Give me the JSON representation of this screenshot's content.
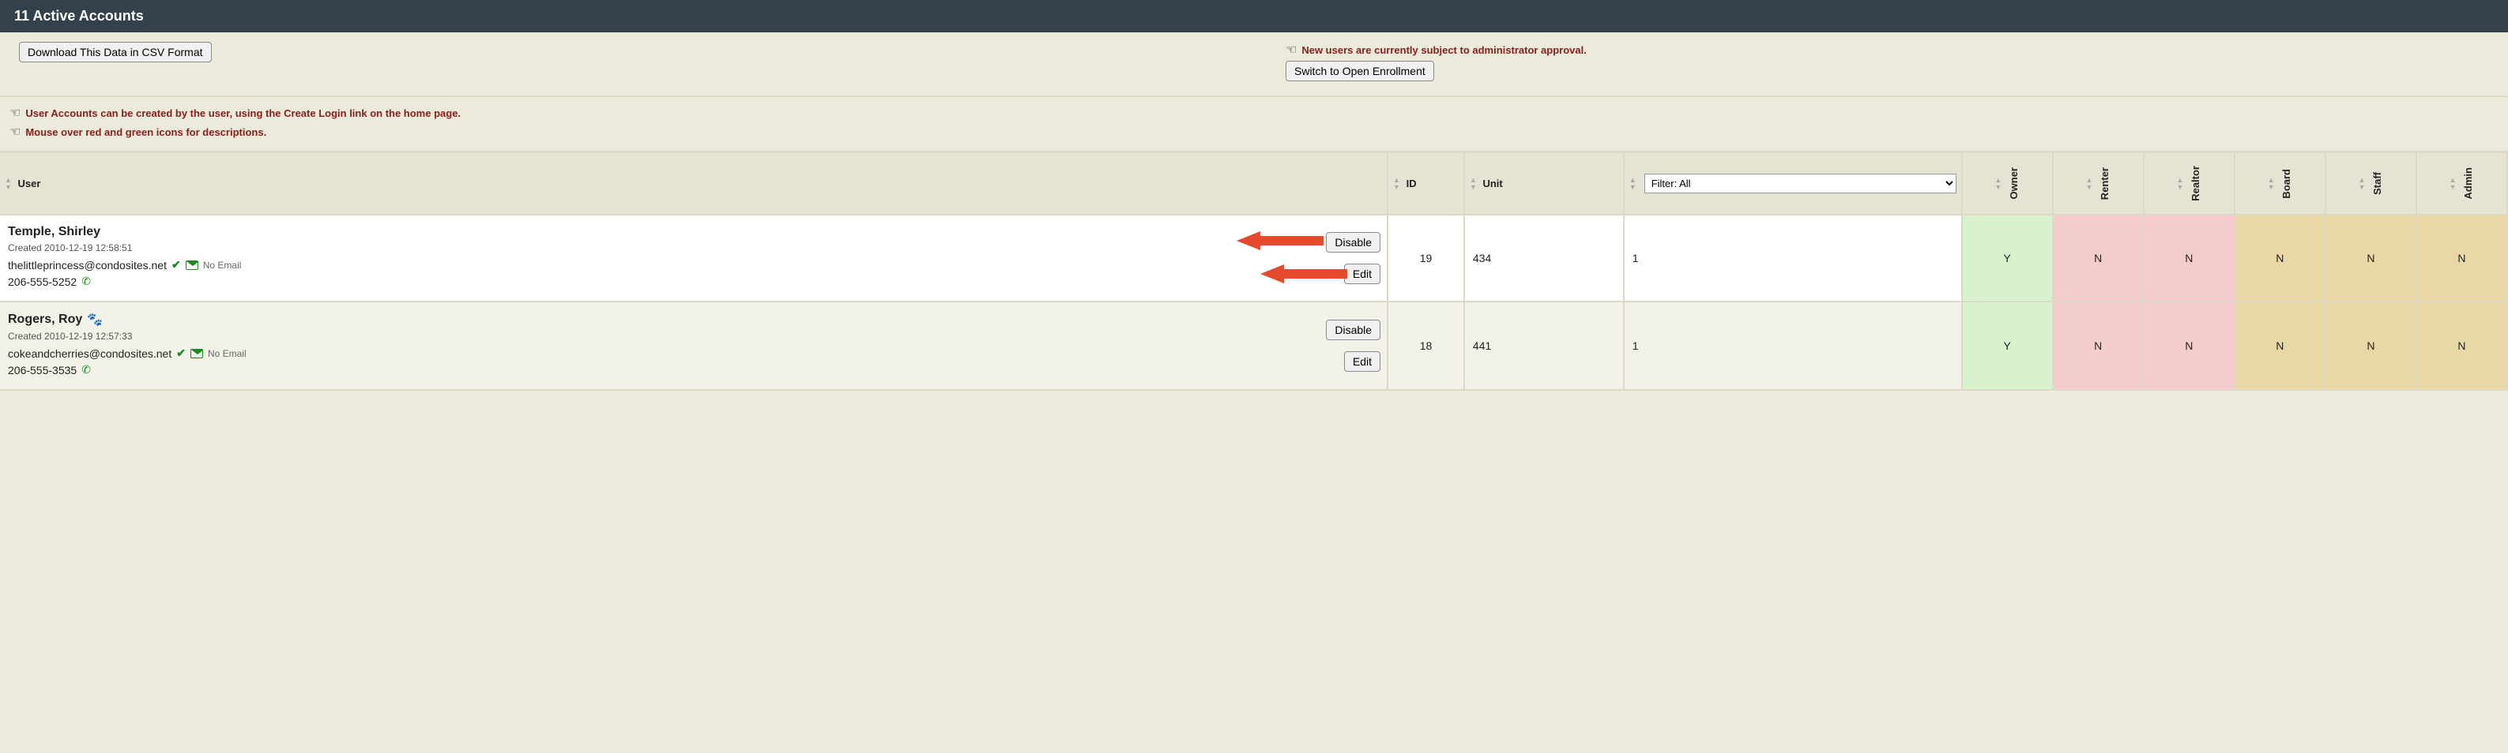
{
  "header": {
    "title": "11 Active Accounts"
  },
  "toolbar": {
    "download_csv_label": "Download This Data in CSV Format",
    "approval_note": "New users are currently subject to administrator approval.",
    "switch_enrollment_label": "Switch to Open Enrollment"
  },
  "notes": {
    "create_login_note": "User Accounts can be created by the user, using the Create Login link on the home page.",
    "mouseover_note": "Mouse over red and green icons for descriptions."
  },
  "columns": {
    "user": "User",
    "id": "ID",
    "unit": "Unit",
    "filter_selected": "Filter: All",
    "owner": "Owner",
    "renter": "Renter",
    "realtor": "Realtor",
    "board": "Board",
    "staff": "Staff",
    "admin": "Admin"
  },
  "actions": {
    "disable": "Disable",
    "edit": "Edit",
    "no_email": "No Email"
  },
  "rows": [
    {
      "name": "Temple, Shirley",
      "created": "Created 2010-12-19 12:58:51",
      "email": "thelittleprincess@condosites.net",
      "phone": "206-555-5252",
      "has_pet": false,
      "id": "19",
      "unit": "434",
      "filter": "1",
      "owner": "Y",
      "renter": "N",
      "realtor": "N",
      "board": "N",
      "staff": "N",
      "admin": "N",
      "show_arrows": true
    },
    {
      "name": "Rogers, Roy",
      "created": "Created 2010-12-19 12:57:33",
      "email": "cokeandcherries@condosites.net",
      "phone": "206-555-3535",
      "has_pet": true,
      "id": "18",
      "unit": "441",
      "filter": "1",
      "owner": "Y",
      "renter": "N",
      "realtor": "N",
      "board": "N",
      "staff": "N",
      "admin": "N",
      "show_arrows": false
    }
  ]
}
